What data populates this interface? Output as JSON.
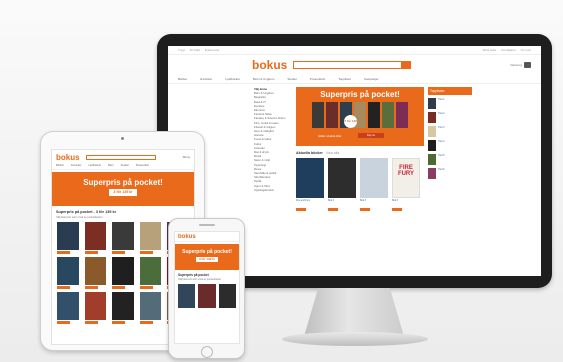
{
  "colors": {
    "brand": "#e86a1a"
  },
  "desktop": {
    "topbar": {
      "left": [
        "Trygt",
        "Fri frakt",
        "Enkel retur"
      ],
      "right": [
        "Mina sidor",
        "Kundtjänst",
        "Om oss",
        "Bokus"
      ]
    },
    "logo": "bokus",
    "cart_label": "Varukorg",
    "nav": [
      "Böcker",
      "E-böcker",
      "Ljudböcker",
      "Barn & Ungdom",
      "Studier",
      "Presentkort",
      "Topplistor",
      "Kampanjer"
    ],
    "sidebar": {
      "heading": "Välj ämne",
      "items": [
        "Barn & Ungdom",
        "Biografier",
        "Data & IT",
        "Deckare",
        "Ekonomi",
        "Familj & hälsa",
        "Fantasy & Science fiction",
        "Film, musik & teater",
        "Filosofi & religion",
        "Hem & trädgård",
        "Historia",
        "Konst & kultur",
        "Kultur",
        "Litteratur",
        "Mat & dryck",
        "Musik",
        "Natur & miljö",
        "Psykologi",
        "Resor",
        "Samhälle & politik",
        "Skönlitteratur",
        "Språk",
        "Sport & fritid",
        "Uppslagsböcker"
      ]
    },
    "banner": {
      "title": "Superpris på pocket!",
      "price": "3 för 139 kr",
      "cta": "Köp nu",
      "subtitle": "Gäller utvalda titlar"
    },
    "section": {
      "title": "Aktuella böcker",
      "more": "Visa alla"
    },
    "grid": [
      "Fire and Fury",
      "Bok 2",
      "Bok 3",
      "Bok 4"
    ],
    "right": {
      "heading": "Topplistan",
      "items": [
        "Titel 1",
        "Titel 2",
        "Titel 3",
        "Titel 4",
        "Titel 5",
        "Titel 6"
      ]
    }
  },
  "tablet": {
    "logo": "bokus",
    "menu": "Meny",
    "nav": [
      "Böcker",
      "E-böcker",
      "Ljudböcker",
      "Barn",
      "Studier",
      "Presentkort"
    ],
    "banner": {
      "title": "Superpris på pocket!",
      "price": "3 för 139 kr"
    },
    "section": {
      "title": "Superpris på pocket - 3 för 139 kr",
      "text": "Välj bland ett stort urval av pocketböcker"
    },
    "grid_count": 15
  },
  "phone": {
    "logo": "bokus",
    "banner": {
      "title": "Superpris på pocket!",
      "price": "3 för 139 kr"
    },
    "section": {
      "title": "Superpris på pocket",
      "text": "Välj bland ett stort urval av pocketböcker"
    }
  }
}
